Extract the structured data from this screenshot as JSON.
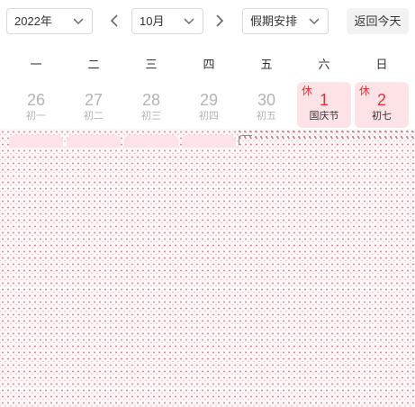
{
  "toolbar": {
    "year_value": "2022年",
    "month_value": "10月",
    "mode_value": "假期安排",
    "today_label": "返回今天"
  },
  "weekdays": [
    "一",
    "二",
    "三",
    "四",
    "五",
    "六",
    "日"
  ],
  "days": [
    {
      "num": "26",
      "sub": "初一",
      "type": "other",
      "rest": ""
    },
    {
      "num": "27",
      "sub": "初二",
      "type": "other",
      "rest": ""
    },
    {
      "num": "28",
      "sub": "初三",
      "type": "other",
      "rest": ""
    },
    {
      "num": "29",
      "sub": "初四",
      "type": "other",
      "rest": ""
    },
    {
      "num": "30",
      "sub": "初五",
      "type": "other",
      "rest": ""
    },
    {
      "num": "1",
      "sub": "国庆节",
      "type": "holiday",
      "rest": "休"
    },
    {
      "num": "2",
      "sub": "初七",
      "type": "holiday",
      "rest": "休"
    }
  ],
  "colors": {
    "holiday_bg": "#fde3e5",
    "holiday_text": "#e0333d",
    "muted_text": "#b3b3b3"
  },
  "icons": {
    "select_caret": "chevron-down-icon",
    "prev": "chevron-left-icon",
    "next": "chevron-right-icon"
  }
}
